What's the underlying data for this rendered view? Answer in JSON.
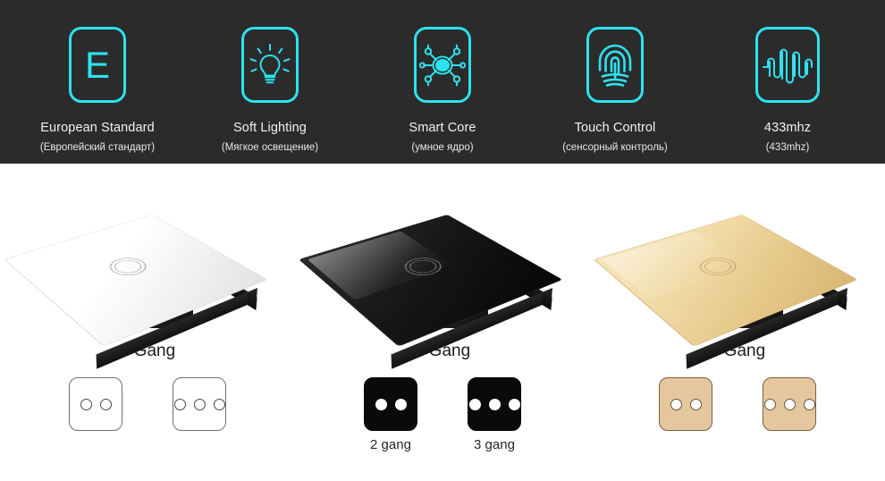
{
  "banner": {
    "background_color": "#2b2b2b",
    "accent_color": "#2de2f0",
    "features": [
      {
        "icon": "letter-e-european-standard-icon",
        "letter": "E",
        "label_en": "European Standard",
        "label_ru": "(Европейский стандарт)"
      },
      {
        "icon": "light-bulb-icon",
        "letter": "",
        "label_en": "Soft Lighting",
        "label_ru": "(Мягкое освещение)"
      },
      {
        "icon": "smart-core-chip-icon",
        "letter": "",
        "label_en": "Smart Core",
        "label_ru": "(умное ядро)"
      },
      {
        "icon": "fingerprint-icon",
        "letter": "",
        "label_en": "Touch Control",
        "label_ru": "(сенсорный контроль)"
      },
      {
        "icon": "radio-waveform-icon",
        "letter": "",
        "label_en": "433mhz",
        "label_ru": "(433mhz)"
      }
    ]
  },
  "products": [
    {
      "color_name": "white",
      "plate_class": "plate-white",
      "ring_class": "light",
      "gang_title": "1 Gang",
      "variant_theme": "theme-white",
      "variants": [
        {
          "dots": 2,
          "caption": ""
        },
        {
          "dots": 3,
          "caption": ""
        }
      ]
    },
    {
      "color_name": "black",
      "plate_class": "plate-black",
      "ring_class": "light",
      "gang_title": "1 Gang",
      "variant_theme": "theme-black",
      "variants": [
        {
          "dots": 2,
          "caption": "2 gang"
        },
        {
          "dots": 3,
          "caption": "3 gang"
        }
      ]
    },
    {
      "color_name": "gold",
      "plate_class": "plate-gold",
      "ring_class": "gold",
      "gang_title": "1 Gang",
      "variant_theme": "theme-gold",
      "variants": [
        {
          "dots": 2,
          "caption": ""
        },
        {
          "dots": 3,
          "caption": ""
        }
      ]
    }
  ]
}
